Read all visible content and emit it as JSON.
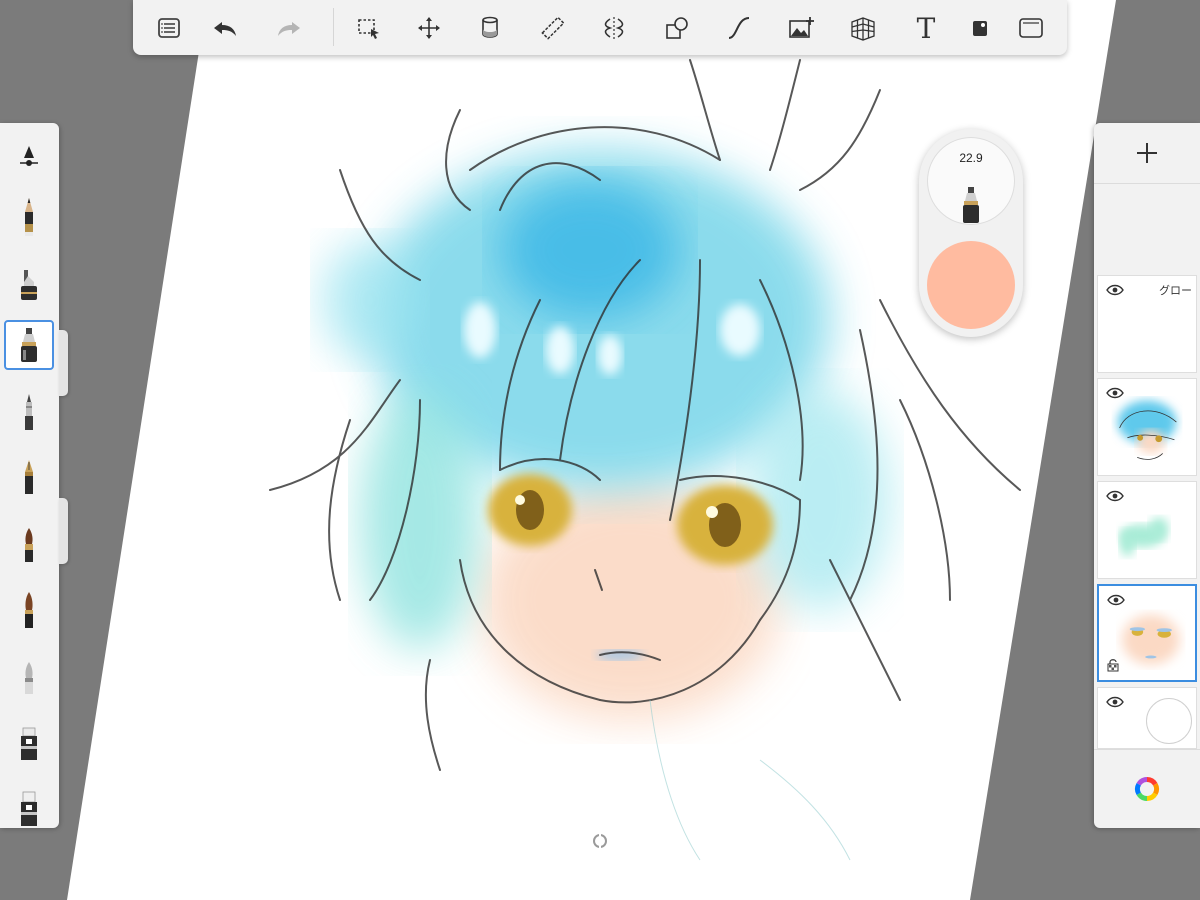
{
  "toolbar": {
    "buttons": [
      {
        "name": "layers-list-button",
        "icon": "list-icon"
      },
      {
        "name": "undo-button",
        "icon": "undo-icon"
      },
      {
        "name": "redo-button",
        "icon": "redo-icon"
      },
      {
        "name": "selection-button",
        "icon": "marquee-select-icon"
      },
      {
        "name": "transform-button",
        "icon": "move-icon"
      },
      {
        "name": "fill-button",
        "icon": "paint-bucket-icon"
      },
      {
        "name": "ruler-button",
        "icon": "ruler-icon"
      },
      {
        "name": "symmetry-button",
        "icon": "symmetry-icon"
      },
      {
        "name": "shapes-button",
        "icon": "shapes-icon"
      },
      {
        "name": "stroke-button",
        "icon": "curve-icon"
      },
      {
        "name": "image-button",
        "icon": "add-image-icon"
      },
      {
        "name": "perspective-button",
        "icon": "perspective-grid-icon"
      },
      {
        "name": "text-button",
        "icon": "text-icon",
        "label": "T"
      },
      {
        "name": "tools-button",
        "icon": "square-dot-icon"
      },
      {
        "name": "fullscreen-button",
        "icon": "fullscreen-icon"
      }
    ]
  },
  "brushes": [
    {
      "name": "brush-settings",
      "icon": "brush-settings-icon"
    },
    {
      "name": "pencil",
      "icon": "pencil-icon"
    },
    {
      "name": "airbrush",
      "icon": "airbrush-icon"
    },
    {
      "name": "marker-selected",
      "icon": "marker-icon",
      "selected": true
    },
    {
      "name": "ballpoint",
      "icon": "ballpoint-pen-icon"
    },
    {
      "name": "fountain-pen",
      "icon": "fountain-pen-icon"
    },
    {
      "name": "paint-brush",
      "icon": "paint-brush-icon"
    },
    {
      "name": "ink-brush",
      "icon": "ink-brush-icon"
    },
    {
      "name": "smudge",
      "icon": "smudge-icon"
    },
    {
      "name": "eraser",
      "icon": "eraser-icon"
    },
    {
      "name": "eraser-hard",
      "icon": "eraser-hard-icon"
    }
  ],
  "layers_panel": {
    "add_icon": "plus-icon",
    "layers": [
      {
        "name": "グロー",
        "visible": true
      },
      {
        "name": "",
        "visible": true
      },
      {
        "name": "",
        "visible": true
      },
      {
        "name": "",
        "visible": true,
        "selected": true,
        "locked": true
      },
      {
        "name": "",
        "visible": true
      }
    ],
    "color_wheel_icon": "color-wheel-icon"
  },
  "brush_puck": {
    "size": "22.9",
    "color": "#ffbba0"
  }
}
